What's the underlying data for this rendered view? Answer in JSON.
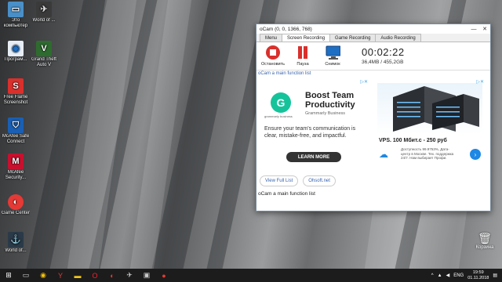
{
  "window": {
    "title": "oCam (0, 0, 1366, 768)",
    "tabs": [
      "Menu",
      "Screen Recording",
      "Game Recording",
      "Audio Recording"
    ],
    "active_tab": "Screen Recording",
    "toolbar": {
      "stop_label": "Остановить",
      "pause_label": "Пауза",
      "snapshot_label": "Снимок"
    },
    "timer": "00:02:22",
    "size": "36,4MB / 455,2GB",
    "top_link": "oCam a main function list",
    "bottom_link": "oCam a main function list",
    "buttons": {
      "full_list": "View Full List",
      "site": "Ohsoft.net"
    }
  },
  "ad_grammarly": {
    "logo_sub": "grammarly business",
    "headline": "Boost Team Productivity",
    "subhead": "Grammarly Business",
    "body": "Ensure your team's communication is clear, mistake-free, and impactful.",
    "cta": "LEARN MORE"
  },
  "ad_vps": {
    "price": "VPS. 100 Мбит.с - 250 руб",
    "desc": "Доступность 99.9753%, Дата-центр в Москве. Тех. поддержка 24/7. Нам выбирает Профи."
  },
  "desktop_icons": [
    {
      "label": "Это компьютер"
    },
    {
      "label": "World of ..."
    },
    {
      "label": "Програм..."
    },
    {
      "label": "Grand Theft Auto V"
    },
    {
      "label": "Free Flame Screenshot"
    },
    {
      "label": "McAfee Safe Connect"
    },
    {
      "label": "McAfee Security..."
    },
    {
      "label": "Game Center"
    },
    {
      "label": "World of..."
    }
  ],
  "recycle_bin": "Корзина",
  "tray": {
    "lang": "ENG",
    "time": "19:59",
    "date": "01.11.2018"
  },
  "colors": {
    "accent": "#15c39a",
    "link": "#3a66b0",
    "rec_red": "#d9302c"
  }
}
